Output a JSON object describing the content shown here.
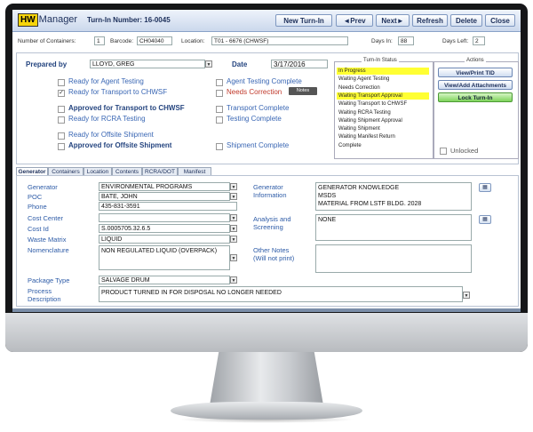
{
  "app": {
    "logo_hw": "HW",
    "logo_manager": "Manager",
    "turnin_label": "Turn-In Number: 16-0045",
    "buttons": {
      "new": "New Turn-In",
      "prev": "◄Prev",
      "next": "Next►",
      "refresh": "Refresh",
      "delete": "Delete",
      "close": "Close"
    }
  },
  "info": {
    "containers_label": "Number of Containers:",
    "containers_value": "1",
    "barcode_label": "Barcode:",
    "barcode_value": "CH04040",
    "location_label": "Location:",
    "location_value": "T01 - 6676 (CHWSF)",
    "days_in_label": "Days In:",
    "days_in_value": "88",
    "days_left_label": "Days Left:",
    "days_left_value": "2"
  },
  "main": {
    "prepared_by_label": "Prepared by",
    "prepared_by_value": "LLOYD, GREG",
    "date_label": "Date",
    "date_value": "3/17/2016",
    "checks": {
      "agent_testing": "Ready for Agent Testing",
      "transport_chwsf": "Ready for Transport to CHWSF",
      "approved_transport": "Approved for Transport to CHWSF",
      "rcra_testing": "Ready for RCRA Testing",
      "offsite_shipment": "Ready for Offsite Shipment",
      "approved_offsite": "Approved for Offsite Shipment",
      "agent_testing_complete": "Agent Testing Complete",
      "needs_correction": "Needs Correction",
      "transport_complete": "Transport Complete",
      "testing_complete": "Testing Complete",
      "shipment_complete": "Shipment Complete"
    },
    "notes_button": "Notes"
  },
  "status": {
    "title": "Turn-In Status",
    "items": [
      "In Progress",
      "Waiting Agent Testing",
      "Needs Correction",
      "Waiting Transport Approval",
      "Waiting Transport to CHWSF",
      "Waiting RCRA Testing",
      "Waiting Shipment Approval",
      "Waiting Shipment",
      "Waiting Manifest Return",
      "Complete"
    ],
    "highlight_color": "#ffff33"
  },
  "actions": {
    "title": "Actions",
    "view_print": "View/Print TID",
    "view_add": "View/Add Attachments",
    "lock": "Lock Turn-In",
    "unlocked_label": "Unlocked"
  },
  "tabs": [
    "Generator",
    "Containers",
    "Location",
    "Contents",
    "RCRA/DOT",
    "Manifest"
  ],
  "generator": {
    "generator_label": "Generator",
    "generator_value": "ENVIRONMENTAL PROGRAMS",
    "poc_label": "POC",
    "poc_value": "BATE, JOHN",
    "phone_label": "Phone",
    "phone_value": "435-831-3591",
    "cost_center_label": "Cost Center",
    "cost_center_value": "",
    "cost_id_label": "Cost Id",
    "cost_id_value": "S.0005705.32.6.5",
    "waste_matrix_label": "Waste Matrix",
    "waste_matrix_value": "LIQUID",
    "nomenclature_label": "Nomenclature",
    "nomenclature_value": "NON REGULATED LIQUID (OVERPACK)",
    "package_type_label": "Package Type",
    "package_type_value": "SALVAGE DRUM",
    "process_label_1": "Process",
    "process_label_2": "Description",
    "process_value": "PRODUCT TURNED IN FOR DISPOSAL NO LONGER NEEDED",
    "gen_info_label_1": "Generator",
    "gen_info_label_2": "Information",
    "gen_info_lines": [
      "GENERATOR KNOWLEDGE",
      "MSDS",
      "MATERIAL FROM LSTF BLDG. 2028"
    ],
    "analysis_label_1": "Analysis and",
    "analysis_label_2": "Screening",
    "analysis_value": "NONE",
    "other_notes_label_1": "Other Notes",
    "other_notes_label_2": "(Will not print)"
  }
}
